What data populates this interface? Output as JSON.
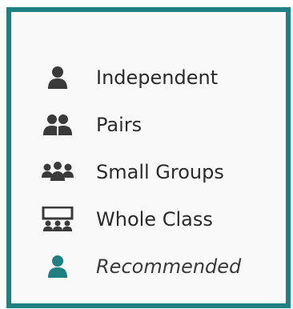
{
  "legend": {
    "items": [
      {
        "label": "Independent",
        "icon": "person-icon",
        "color": "#3a3a3a"
      },
      {
        "label": "Pairs",
        "icon": "pair-icon",
        "color": "#3a3a3a"
      },
      {
        "label": "Small Groups",
        "icon": "group-icon",
        "color": "#3a3a3a"
      },
      {
        "label": "Whole Class",
        "icon": "classroom-icon",
        "color": "#3a3a3a"
      },
      {
        "label": "Recommended",
        "icon": "person-icon",
        "color": "#1f7f81"
      }
    ],
    "border_color": "#1f7f81"
  }
}
